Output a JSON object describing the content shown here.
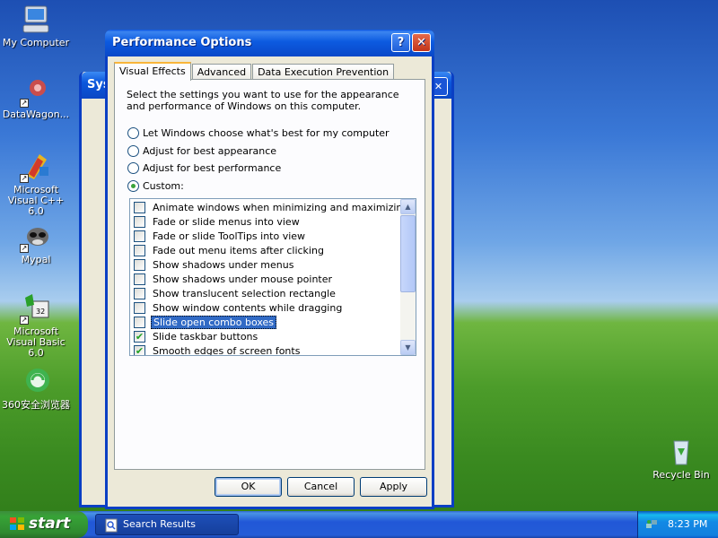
{
  "desktop": {
    "icons": [
      {
        "label": "My Computer"
      },
      {
        "label": "DataWagon..."
      },
      {
        "label": "Microsoft Visual C++ 6.0"
      },
      {
        "label": "Mypal"
      },
      {
        "label": "Microsoft Visual Basic 6.0"
      },
      {
        "label": "360安全浏览器"
      },
      {
        "label": "Recycle Bin"
      }
    ]
  },
  "background_window": {
    "title": "Syst",
    "close_glyph": "✕"
  },
  "dialog": {
    "title": "Performance Options",
    "help_glyph": "?",
    "close_glyph": "✕",
    "tabs": [
      {
        "label": "Visual Effects",
        "active": true
      },
      {
        "label": "Advanced",
        "active": false
      },
      {
        "label": "Data Execution Prevention",
        "active": false
      }
    ],
    "intro": "Select the settings you want to use for the appearance and performance of Windows on this computer.",
    "radios": [
      {
        "label": "Let Windows choose what's best for my computer",
        "checked": false
      },
      {
        "label": "Adjust for best appearance",
        "checked": false
      },
      {
        "label": "Adjust for best performance",
        "checked": false
      },
      {
        "label": "Custom:",
        "checked": true
      }
    ],
    "effects": [
      {
        "label": "Animate windows when minimizing and maximizing",
        "checked": false,
        "selected": false
      },
      {
        "label": "Fade or slide menus into view",
        "checked": false,
        "selected": false
      },
      {
        "label": "Fade or slide ToolTips into view",
        "checked": false,
        "selected": false
      },
      {
        "label": "Fade out menu items after clicking",
        "checked": false,
        "selected": false
      },
      {
        "label": "Show shadows under menus",
        "checked": false,
        "selected": false
      },
      {
        "label": "Show shadows under mouse pointer",
        "checked": false,
        "selected": false
      },
      {
        "label": "Show translucent selection rectangle",
        "checked": false,
        "selected": false
      },
      {
        "label": "Show window contents while dragging",
        "checked": false,
        "selected": false
      },
      {
        "label": "Slide open combo boxes",
        "checked": false,
        "selected": true
      },
      {
        "label": "Slide taskbar buttons",
        "checked": true,
        "selected": false
      },
      {
        "label": "Smooth edges of screen fonts",
        "checked": true,
        "selected": false
      }
    ],
    "check_glyph": "✔",
    "scroll_up_glyph": "▲",
    "scroll_down_glyph": "▼",
    "buttons": {
      "ok": "OK",
      "cancel": "Cancel",
      "apply": "Apply"
    }
  },
  "taskbar": {
    "start_label": "start",
    "task_label": "Search Results",
    "clock": "8:23 PM"
  },
  "colors": {
    "title_blue": "#0a48c8",
    "selection": "#316ac5",
    "tab_highlight": "#f9b53a",
    "check_green": "#21a121"
  }
}
